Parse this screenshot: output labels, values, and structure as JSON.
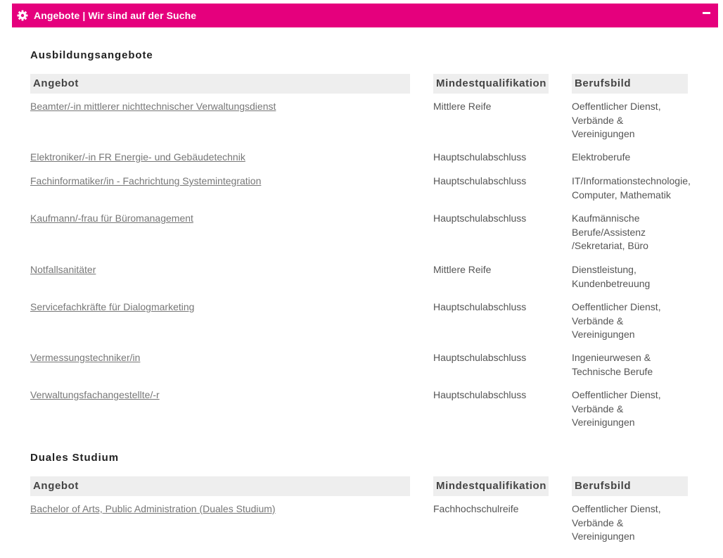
{
  "panel": {
    "title": "Angebote | Wir sind auf der Suche"
  },
  "sections": [
    {
      "title": "Ausbildungsangebote",
      "headers": {
        "angebot": "Angebot",
        "quali": "Mindestqualifikation",
        "beruf": "Berufsbild"
      },
      "rows": [
        {
          "angebot": "Beamter/-in mittlerer nichttechnischer Verwaltungsdienst",
          "quali": "Mittlere Reife",
          "beruf": [
            "Oeffentlicher Dienst,",
            "Verbände &",
            "Vereinigungen"
          ]
        },
        {
          "angebot": "Elektroniker/-in FR Energie- und Gebäudetechnik",
          "quali": "Hauptschulabschluss",
          "beruf": [
            "Elektroberufe"
          ]
        },
        {
          "angebot": "Fachinformatiker/in - Fachrichtung Systemintegration",
          "quali": "Hauptschulabschluss",
          "beruf": [
            "IT/Informationstechnologie,",
            "Computer, Mathematik"
          ]
        },
        {
          "angebot": "Kaufmann/-frau für Büromanagement",
          "quali": "Hauptschulabschluss",
          "beruf": [
            "Kaufmännische",
            "Berufe/Assistenz",
            "/Sekretariat, Büro"
          ]
        },
        {
          "angebot": "Notfallsanitäter",
          "quali": "Mittlere Reife",
          "beruf": [
            "Dienstleistung,",
            "Kundenbetreuung"
          ]
        },
        {
          "angebot": "Servicefachkräfte für Dialogmarketing",
          "quali": "Hauptschulabschluss",
          "beruf": [
            "Oeffentlicher Dienst,",
            "Verbände &",
            "Vereinigungen"
          ]
        },
        {
          "angebot": "Vermessungstechniker/in",
          "quali": "Hauptschulabschluss",
          "beruf": [
            "Ingenieurwesen &",
            "Technische Berufe"
          ]
        },
        {
          "angebot": "Verwaltungsfachangestellte/-r",
          "quali": "Hauptschulabschluss",
          "beruf": [
            "Oeffentlicher Dienst,",
            "Verbände &",
            "Vereinigungen"
          ]
        }
      ]
    },
    {
      "title": "Duales Studium",
      "headers": {
        "angebot": "Angebot",
        "quali": "Mindestqualifikation",
        "beruf": "Berufsbild"
      },
      "rows": [
        {
          "angebot": "Bachelor of Arts, Public Administration (Duales Studium)",
          "quali": "Fachhochschulreife",
          "beruf": [
            "Oeffentlicher Dienst,",
            "Verbände &",
            "Vereinigungen"
          ]
        }
      ]
    }
  ]
}
